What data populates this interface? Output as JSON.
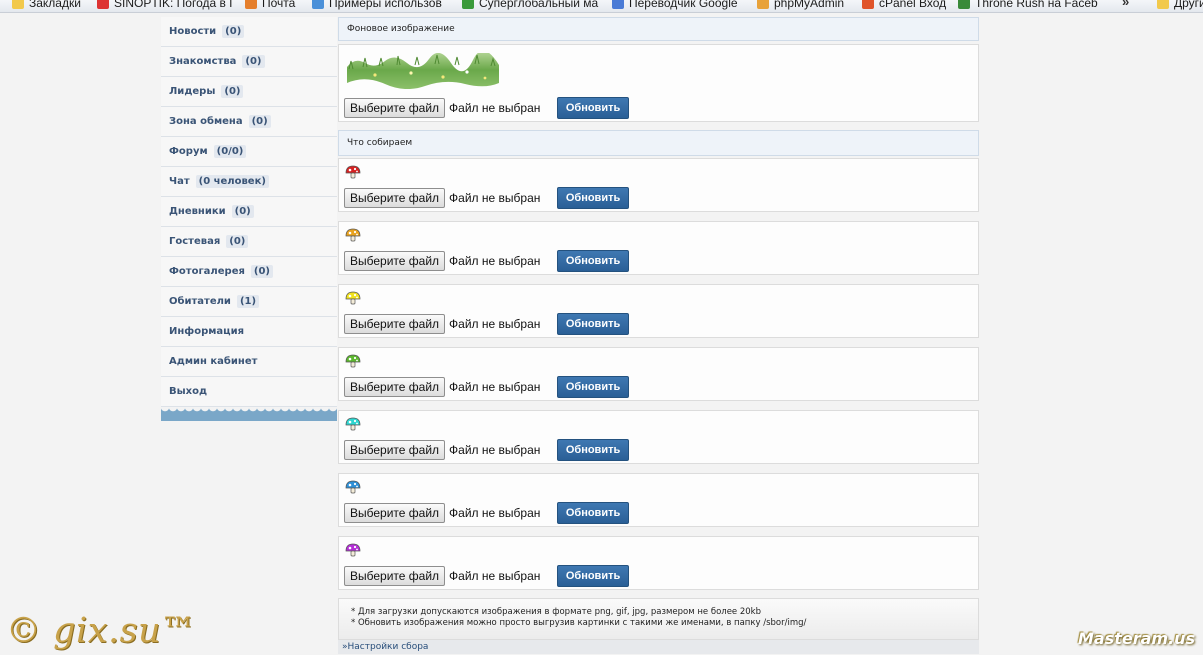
{
  "bookmarks": {
    "items": [
      {
        "label": "Закладки",
        "icon": "folder-icon",
        "color": "#f2c94c"
      },
      {
        "label": "SINOPTIK: Погода в Г",
        "icon": "thermometer-icon",
        "color": "#d33"
      },
      {
        "label": "Почта",
        "icon": "mail-icon",
        "color": "#e57f2d"
      },
      {
        "label": "Примеры использов",
        "icon": "w-icon",
        "color": "#4a90d9"
      },
      {
        "label": "Суперглобальный ма",
        "icon": "check-icon",
        "color": "#3a9a3a"
      },
      {
        "label": "Переводчик Google",
        "icon": "translate-icon",
        "color": "#4a7bd6"
      },
      {
        "label": "phpMyAdmin",
        "icon": "pma-icon",
        "color": "#e8a23a"
      },
      {
        "label": "cPanel Вход",
        "icon": "cpanel-icon",
        "color": "#e0542a"
      },
      {
        "label": "Throne Rush на Faceb",
        "icon": "crown-icon",
        "color": "#3a8a3a"
      },
      {
        "label": "Другие",
        "icon": "folder-icon",
        "color": "#f2c94c"
      }
    ],
    "more": "»"
  },
  "menu": {
    "items": [
      {
        "label": "Новости",
        "count": "(0)"
      },
      {
        "label": "Знакомства",
        "count": "(0)"
      },
      {
        "label": "Лидеры",
        "count": "(0)"
      },
      {
        "label": "Зона обмена",
        "count": "(0)"
      },
      {
        "label": "Форум",
        "count": "(0/0)"
      },
      {
        "label": "Чат",
        "count": "(0 человек)"
      },
      {
        "label": "Дневники",
        "count": "(0)"
      },
      {
        "label": "Гостевая",
        "count": "(0)"
      },
      {
        "label": "Фотогалерея",
        "count": "(0)"
      },
      {
        "label": "Обитатели",
        "count": "(1)"
      },
      {
        "label": "Информация",
        "count": ""
      },
      {
        "label": "Админ кабинет",
        "count": ""
      },
      {
        "label": "Выход",
        "count": ""
      }
    ]
  },
  "background_section": {
    "title": "Фоновое изображение",
    "choose_label": "Выберите файл",
    "status": "Файл не выбран",
    "update_label": "Обновить"
  },
  "collect_section": {
    "title": "Что собираем",
    "choose_label": "Выберите файл",
    "status": "Файл не выбран",
    "update_label": "Обновить",
    "items": [
      {
        "icon": "mushroom-icon",
        "color": "#d62222"
      },
      {
        "icon": "mushroom-icon",
        "color": "#e8a21e"
      },
      {
        "icon": "mushroom-icon",
        "color": "#f0e21e"
      },
      {
        "icon": "mushroom-icon",
        "color": "#5cb82e"
      },
      {
        "icon": "mushroom-icon",
        "color": "#2ed6d0"
      },
      {
        "icon": "mushroom-icon",
        "color": "#2e8fd6"
      },
      {
        "icon": "mushroom-icon",
        "color": "#b42ed6"
      }
    ]
  },
  "notes": {
    "line1": "* Для загрузки допускаются изображения в формате png, gif, jpg, размером не более 20kb",
    "line2": "* Обновить изображения можно просто выгрузив картинки с такими же именами, в папку /sbor/img/"
  },
  "settings_link": "»Настройки сбора",
  "watermark": "© gix.su™",
  "logo": "Masteram.us"
}
